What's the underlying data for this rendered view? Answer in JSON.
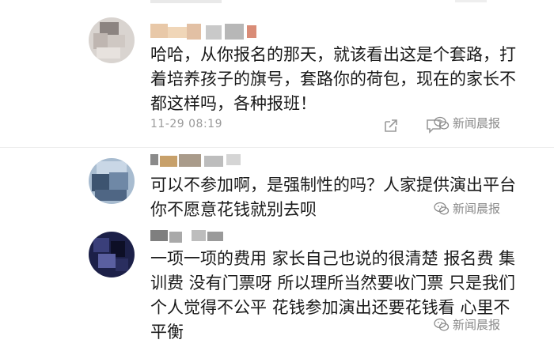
{
  "comments": [
    {
      "text_lines": [
        "哈哈，从你报名的那天，就该看出这是个套路，打",
        "着培养孩子的旗号，套路你的荷包，现在的家长不",
        "都这样吗，各种报班！"
      ],
      "timestamp": "11-29 08:19",
      "watermark": "新闻晨报"
    },
    {
      "text_lines": [
        "可以不参加啊，是强制性的吗？人家提供演出平台",
        "你不愿意花钱就别去呗"
      ],
      "watermark": "新闻晨报"
    },
    {
      "text_lines": [
        "一项一项的费用 家长自己也说的很清楚 报名费 集",
        "训费 没有门票呀 所以理所当然要收门票 只是我们",
        "个人觉得不公平 花钱参加演出还要花钱看 心里不",
        "平衡"
      ],
      "watermark": "新闻晨报"
    }
  ],
  "icons": {
    "share": "share-icon",
    "comment": "comment-icon",
    "watermark": "wechat-logo-icon"
  },
  "colors": {
    "text": "#1a1a1a",
    "meta": "#9a9a9a",
    "watermark": "#8a8a8a"
  }
}
